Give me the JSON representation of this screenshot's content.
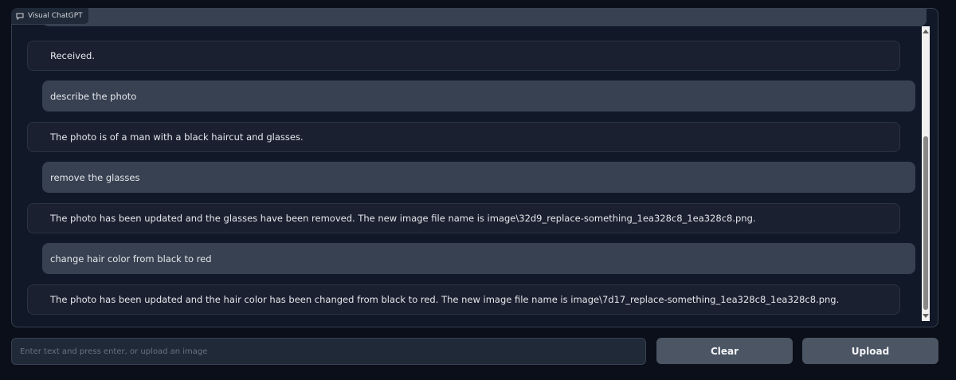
{
  "panel": {
    "label": "Visual ChatGPT",
    "label_icon": "chat-bubble-icon"
  },
  "messages": [
    {
      "role": "bot",
      "text": "Received."
    },
    {
      "role": "user",
      "text": "describe the photo"
    },
    {
      "role": "bot",
      "text": "The photo is of a man with a black haircut and glasses."
    },
    {
      "role": "user",
      "text": "remove the glasses"
    },
    {
      "role": "bot",
      "text": "The photo has been updated and the glasses have been removed. The new image file name is image\\32d9_replace-something_1ea328c8_1ea328c8.png."
    },
    {
      "role": "user",
      "text": "change hair color from black to red"
    },
    {
      "role": "bot",
      "text": "The photo has been updated and the hair color has been changed from black to red. The new image file name is image\\7d17_replace-something_1ea328c8_1ea328c8.png."
    }
  ],
  "input": {
    "placeholder": "Enter text and press enter, or upload an image",
    "value": ""
  },
  "buttons": {
    "clear_label": "Clear",
    "upload_label": "Upload"
  },
  "colors": {
    "background": "#0b0f19",
    "panel": "#111827",
    "user_bubble": "#374151",
    "bot_bubble": "#1a2030",
    "button": "#4b5563"
  }
}
